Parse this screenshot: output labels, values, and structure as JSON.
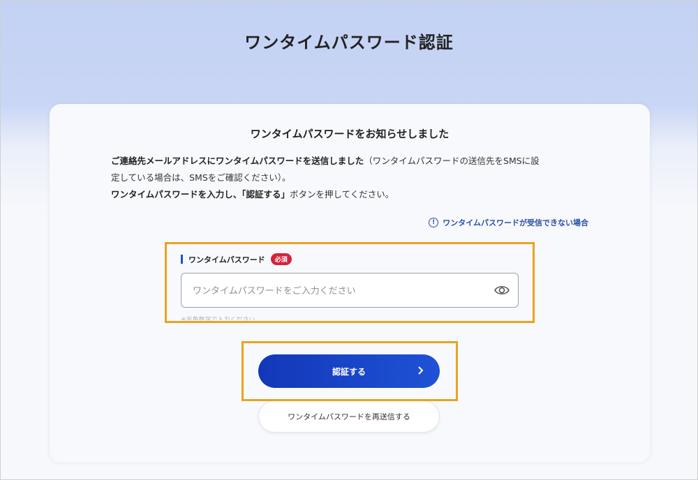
{
  "page": {
    "title": "ワンタイムパスワード認証"
  },
  "card": {
    "title": "ワンタイムパスワードをお知らせしました",
    "desc_line1_bold": "ご連絡先メールアドレスにワンタイムパスワードを送信しました",
    "desc_line1_rest": "（ワンタイムパスワードの送信先をSMSに設",
    "desc_line2": "定している場合は、SMSをご確認ください）。",
    "desc_line3_bold": "ワンタイムパスワードを入力し、「認証する」",
    "desc_line3_rest": "ボタンを押してください。",
    "help_link": "ワンタイムパスワードが受信できない場合"
  },
  "otp_field": {
    "label": "ワンタイムパスワード",
    "required_badge": "必須",
    "value": "",
    "placeholder": "ワンタイムパスワードをご入力ください",
    "hint": "※半角数字で入力ください"
  },
  "buttons": {
    "verify": "認証する",
    "resend": "ワンタイムパスワードを再送信する"
  },
  "colors": {
    "accent": "#1a4fd0",
    "required": "#d6223a",
    "highlight": "#e8a321"
  },
  "icons": {
    "info": "info-circle-icon",
    "eye": "eye-icon",
    "chevron": "chevron-right-icon"
  }
}
